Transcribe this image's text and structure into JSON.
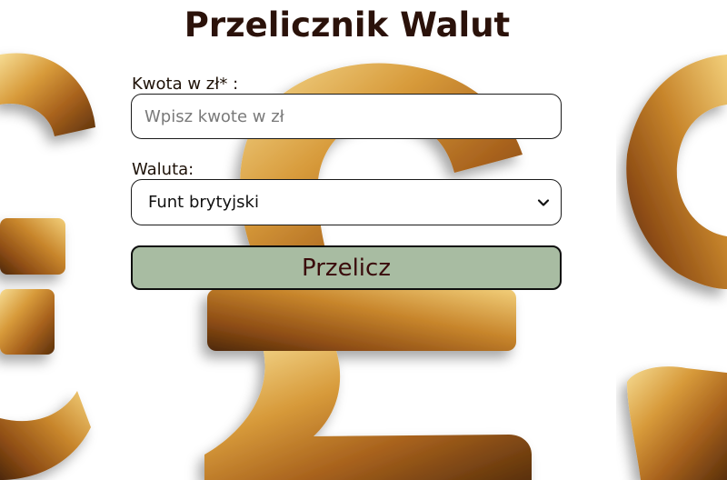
{
  "page": {
    "title": "Przelicznik Walut"
  },
  "form": {
    "amount_label": "Kwota w zł* :",
    "amount_placeholder": "Wpisz kwote w zł",
    "amount_value": "",
    "currency_label": "Waluta:",
    "currency_selected": "Funt brytyjski",
    "submit_label": "Przelicz"
  },
  "colors": {
    "title": "#2b120a",
    "button_bg": "#a8bca2",
    "button_text": "#3a0c0c",
    "gold_light": "#f3d58a",
    "gold_mid": "#c98a2b",
    "gold_dark": "#6b3d10"
  },
  "icons": {
    "select_arrow": "chevron-down-icon"
  }
}
